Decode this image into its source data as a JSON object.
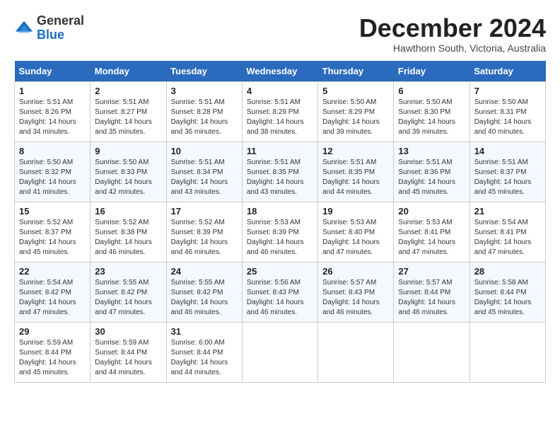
{
  "header": {
    "logo_line1": "General",
    "logo_line2": "Blue",
    "month": "December 2024",
    "location": "Hawthorn South, Victoria, Australia"
  },
  "days_of_week": [
    "Sunday",
    "Monday",
    "Tuesday",
    "Wednesday",
    "Thursday",
    "Friday",
    "Saturday"
  ],
  "weeks": [
    [
      {
        "day": "1",
        "sunrise": "5:51 AM",
        "sunset": "8:26 PM",
        "daylight": "14 hours and 34 minutes."
      },
      {
        "day": "2",
        "sunrise": "5:51 AM",
        "sunset": "8:27 PM",
        "daylight": "14 hours and 35 minutes."
      },
      {
        "day": "3",
        "sunrise": "5:51 AM",
        "sunset": "8:28 PM",
        "daylight": "14 hours and 36 minutes."
      },
      {
        "day": "4",
        "sunrise": "5:51 AM",
        "sunset": "8:29 PM",
        "daylight": "14 hours and 38 minutes."
      },
      {
        "day": "5",
        "sunrise": "5:50 AM",
        "sunset": "8:29 PM",
        "daylight": "14 hours and 39 minutes."
      },
      {
        "day": "6",
        "sunrise": "5:50 AM",
        "sunset": "8:30 PM",
        "daylight": "14 hours and 39 minutes."
      },
      {
        "day": "7",
        "sunrise": "5:50 AM",
        "sunset": "8:31 PM",
        "daylight": "14 hours and 40 minutes."
      }
    ],
    [
      {
        "day": "8",
        "sunrise": "5:50 AM",
        "sunset": "8:32 PM",
        "daylight": "14 hours and 41 minutes."
      },
      {
        "day": "9",
        "sunrise": "5:50 AM",
        "sunset": "8:33 PM",
        "daylight": "14 hours and 42 minutes."
      },
      {
        "day": "10",
        "sunrise": "5:51 AM",
        "sunset": "8:34 PM",
        "daylight": "14 hours and 43 minutes."
      },
      {
        "day": "11",
        "sunrise": "5:51 AM",
        "sunset": "8:35 PM",
        "daylight": "14 hours and 43 minutes."
      },
      {
        "day": "12",
        "sunrise": "5:51 AM",
        "sunset": "8:35 PM",
        "daylight": "14 hours and 44 minutes."
      },
      {
        "day": "13",
        "sunrise": "5:51 AM",
        "sunset": "8:36 PM",
        "daylight": "14 hours and 45 minutes."
      },
      {
        "day": "14",
        "sunrise": "5:51 AM",
        "sunset": "8:37 PM",
        "daylight": "14 hours and 45 minutes."
      }
    ],
    [
      {
        "day": "15",
        "sunrise": "5:52 AM",
        "sunset": "8:37 PM",
        "daylight": "14 hours and 45 minutes."
      },
      {
        "day": "16",
        "sunrise": "5:52 AM",
        "sunset": "8:38 PM",
        "daylight": "14 hours and 46 minutes."
      },
      {
        "day": "17",
        "sunrise": "5:52 AM",
        "sunset": "8:39 PM",
        "daylight": "14 hours and 46 minutes."
      },
      {
        "day": "18",
        "sunrise": "5:53 AM",
        "sunset": "8:39 PM",
        "daylight": "14 hours and 46 minutes."
      },
      {
        "day": "19",
        "sunrise": "5:53 AM",
        "sunset": "8:40 PM",
        "daylight": "14 hours and 47 minutes."
      },
      {
        "day": "20",
        "sunrise": "5:53 AM",
        "sunset": "8:41 PM",
        "daylight": "14 hours and 47 minutes."
      },
      {
        "day": "21",
        "sunrise": "5:54 AM",
        "sunset": "8:41 PM",
        "daylight": "14 hours and 47 minutes."
      }
    ],
    [
      {
        "day": "22",
        "sunrise": "5:54 AM",
        "sunset": "8:42 PM",
        "daylight": "14 hours and 47 minutes."
      },
      {
        "day": "23",
        "sunrise": "5:55 AM",
        "sunset": "8:42 PM",
        "daylight": "14 hours and 47 minutes."
      },
      {
        "day": "24",
        "sunrise": "5:55 AM",
        "sunset": "8:42 PM",
        "daylight": "14 hours and 46 minutes."
      },
      {
        "day": "25",
        "sunrise": "5:56 AM",
        "sunset": "8:43 PM",
        "daylight": "14 hours and 46 minutes."
      },
      {
        "day": "26",
        "sunrise": "5:57 AM",
        "sunset": "8:43 PM",
        "daylight": "14 hours and 46 minutes."
      },
      {
        "day": "27",
        "sunrise": "5:57 AM",
        "sunset": "8:44 PM",
        "daylight": "14 hours and 46 minutes."
      },
      {
        "day": "28",
        "sunrise": "5:58 AM",
        "sunset": "8:44 PM",
        "daylight": "14 hours and 45 minutes."
      }
    ],
    [
      {
        "day": "29",
        "sunrise": "5:59 AM",
        "sunset": "8:44 PM",
        "daylight": "14 hours and 45 minutes."
      },
      {
        "day": "30",
        "sunrise": "5:59 AM",
        "sunset": "8:44 PM",
        "daylight": "14 hours and 44 minutes."
      },
      {
        "day": "31",
        "sunrise": "6:00 AM",
        "sunset": "8:44 PM",
        "daylight": "14 hours and 44 minutes."
      },
      null,
      null,
      null,
      null
    ]
  ]
}
